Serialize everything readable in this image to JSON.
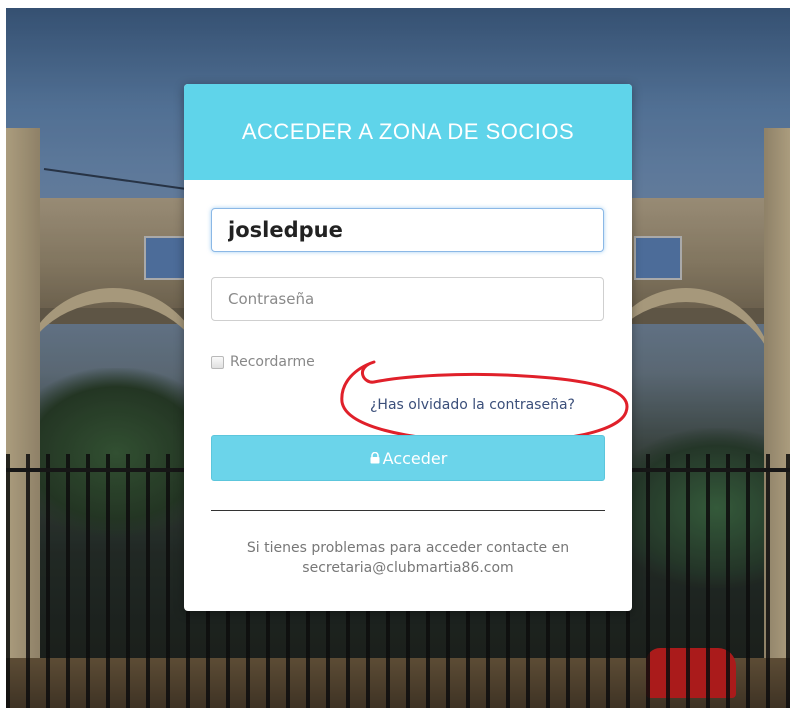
{
  "login": {
    "title": "ACCEDER A ZONA DE SOCIOS",
    "username_value": "josledpue",
    "password_placeholder": "Contraseña",
    "remember_label": "Recordarme",
    "forgot_link": "¿Has olvidado la contraseña?",
    "submit_label": "Acceder",
    "help_line1": "Si tienes problemas para acceder contacte en",
    "help_line2": "secretaria@clubmartia86.com"
  },
  "colors": {
    "header": "#5fd4ea",
    "button": "#6bd4ea",
    "annotation": "#e0202a"
  }
}
